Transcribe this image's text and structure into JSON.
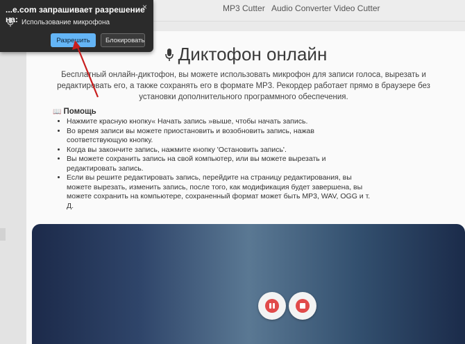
{
  "nav": {
    "mp3_cutter": "MP3 Cutter",
    "audio_converter": "Audio Converter",
    "video_cutter": "Video Cutter"
  },
  "permission_popup": {
    "title": "...e.com запрашивает разрешение на:",
    "close_glyph": "×",
    "permission": "Использование микрофона",
    "allow_label": "Разрешить",
    "block_label": "Блокировать",
    "icon": "microphone-icon"
  },
  "main": {
    "title": "Диктофон онлайн",
    "intro": "Бесплатный онлайн-диктофон, вы можете использовать микрофон для записи голоса, вырезать и редактировать его, а также сохранять его в формате MP3. Рекордер работает прямо в браузере без установки дополнительного программного обеспечения.",
    "help_title": "Помощь",
    "help_items": [
      "Нажмите красную кнопку« Начать запись »выше, чтобы начать запись.",
      "Во время записи вы можете приостановить и возобновить запись, нажав соответствующую кнопку.",
      "Когда вы закончите запись, нажмите кнопку 'Остановить запись'.",
      "Вы можете сохранить запись на свой компьютер, или вы можете вырезать и редактировать запись.",
      "Если вы решите редактировать запись, перейдите на страницу редактирования, вы можете вырезать, изменить запись, после того, как модификация будет завершена, вы можете сохранить на компьютере, сохраненный формат может быть MP3, WAV, OGG и т. Д."
    ]
  },
  "recorder": {
    "pause_icon": "pause-icon",
    "stop_icon": "stop-icon"
  },
  "colors": {
    "accent_red": "#e14a4a",
    "allow_blue": "#64b5f6",
    "popup_bg": "#2b2b2b",
    "recorder_dark": "#1c2a4a",
    "recorder_light": "#5a7893"
  }
}
